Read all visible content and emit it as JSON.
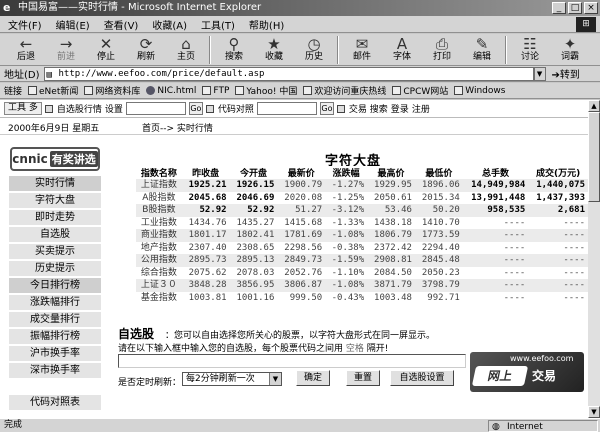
{
  "window": {
    "title": "中国易富——实时行情 - Microsoft Internet Explorer",
    "controls": [
      "_",
      "□",
      "×"
    ]
  },
  "menu": [
    "文件(F)",
    "编辑(E)",
    "查看(V)",
    "收藏(A)",
    "工具(T)",
    "帮助(H)"
  ],
  "toolbar": [
    {
      "label": "后退",
      "icon": "←",
      "disabled": false
    },
    {
      "label": "前进",
      "icon": "→",
      "disabled": true
    },
    {
      "label": "停止",
      "icon": "✕",
      "disabled": false
    },
    {
      "label": "刷新",
      "icon": "⟳",
      "disabled": false
    },
    {
      "label": "主页",
      "icon": "⌂",
      "disabled": false
    },
    {
      "label": "搜索",
      "icon": "⚲",
      "disabled": false
    },
    {
      "label": "收藏",
      "icon": "★",
      "disabled": false
    },
    {
      "label": "历史",
      "icon": "◷",
      "disabled": false
    },
    {
      "label": "邮件",
      "icon": "✉",
      "disabled": false
    },
    {
      "label": "字体",
      "icon": "A",
      "disabled": false
    },
    {
      "label": "打印",
      "icon": "⎙",
      "disabled": false
    },
    {
      "label": "编辑",
      "icon": "✎",
      "disabled": false
    },
    {
      "label": "讨论",
      "icon": "☷",
      "disabled": false
    },
    {
      "label": "词霸",
      "icon": "✦",
      "disabled": false
    }
  ],
  "address": {
    "label": "地址(D)",
    "url": "http://www.eefoo.com/price/default.asp",
    "go": "转到"
  },
  "links": {
    "label": "链接",
    "items": [
      "eNet新闻",
      "网络资料库",
      "NIC.html",
      "FTP",
      "Yahoo! 中国",
      "欢迎访问重庆热线",
      "CPCW网站",
      "Windows"
    ]
  },
  "site": {
    "toolbar_items": [
      "工具 多",
      "自选股行情",
      "设置",
      "Go",
      "代码对照",
      "Go",
      "交易 搜索",
      "登录",
      "注册"
    ],
    "date": "2000年6月9日  星期五",
    "breadcrumb": "首页--> 实时行情",
    "logo_left": "cnnic",
    "logo_right": "有奖讲选"
  },
  "nav": [
    "实时行情",
    "字符大盘",
    "即时走势",
    "自选股",
    "买卖提示",
    "历史提示",
    "今日排行榜",
    "涨跌幅排行",
    "成交量排行",
    "振幅排行榜",
    "沪市换手率",
    "深市换手率",
    "代码对照表"
  ],
  "quotes": {
    "title": "字符大盘",
    "headers": [
      "指数名称",
      "昨收盘",
      "今开盘",
      "最新价",
      "涨跌幅",
      "最高价",
      "最低价",
      "总手数",
      "成交(万元)"
    ],
    "rows": [
      [
        "上证指数",
        "1925.21",
        "1926.15",
        "1900.79",
        "-1.27%",
        "1929.95",
        "1896.06",
        "14,949,984",
        "1,440,075"
      ],
      [
        "A股指数",
        "2045.68",
        "2046.69",
        "2020.08",
        "-1.25%",
        "2050.61",
        "2015.34",
        "13,991,448",
        "1,437,393"
      ],
      [
        "B股指数",
        "52.92",
        "52.92",
        "51.27",
        "-3.12%",
        "53.46",
        "50.20",
        "958,535",
        "2,681"
      ],
      [
        "工业指数",
        "1434.76",
        "1435.27",
        "1415.68",
        "-1.33%",
        "1438.18",
        "1410.70",
        "----",
        "----"
      ],
      [
        "商业指数",
        "1801.17",
        "1802.41",
        "1781.69",
        "-1.08%",
        "1806.79",
        "1773.59",
        "----",
        "----"
      ],
      [
        "地产指数",
        "2307.40",
        "2308.65",
        "2298.56",
        "-0.38%",
        "2372.42",
        "2294.40",
        "----",
        "----"
      ],
      [
        "公用指数",
        "2895.73",
        "2895.13",
        "2849.73",
        "-1.59%",
        "2908.81",
        "2845.48",
        "----",
        "----"
      ],
      [
        "综合指数",
        "2075.62",
        "2078.03",
        "2052.76",
        "-1.10%",
        "2084.50",
        "2050.23",
        "----",
        "----"
      ],
      [
        "上证３０",
        "3848.28",
        "3856.95",
        "3806.87",
        "-1.08%",
        "3871.79",
        "3798.79",
        "----",
        "----"
      ],
      [
        "基金指数",
        "1003.81",
        "1001.16",
        "999.50",
        "-0.43%",
        "1003.48",
        "992.71",
        "----",
        "----"
      ]
    ]
  },
  "watchlist": {
    "title": "自选股",
    "desc": "：您可以自由选择您所关心的股票，以字符大盘形式在同一屏显示。",
    "instr_before": "请在以下输入框中输入您的自选股，每个股票代码之间用",
    "instr_hl": "空格",
    "instr_after": "隔开!",
    "refresh_label": "是否定时刷新：",
    "refresh_value": "每2分钟刷新一次",
    "btn_ok": "确定",
    "btn_reset": "重置",
    "btn_settings": "自选股设置"
  },
  "banner": {
    "url": "www.eefoo.com",
    "left": "网上",
    "right": "交易"
  },
  "status": {
    "left": "完成",
    "zone": "Internet"
  }
}
